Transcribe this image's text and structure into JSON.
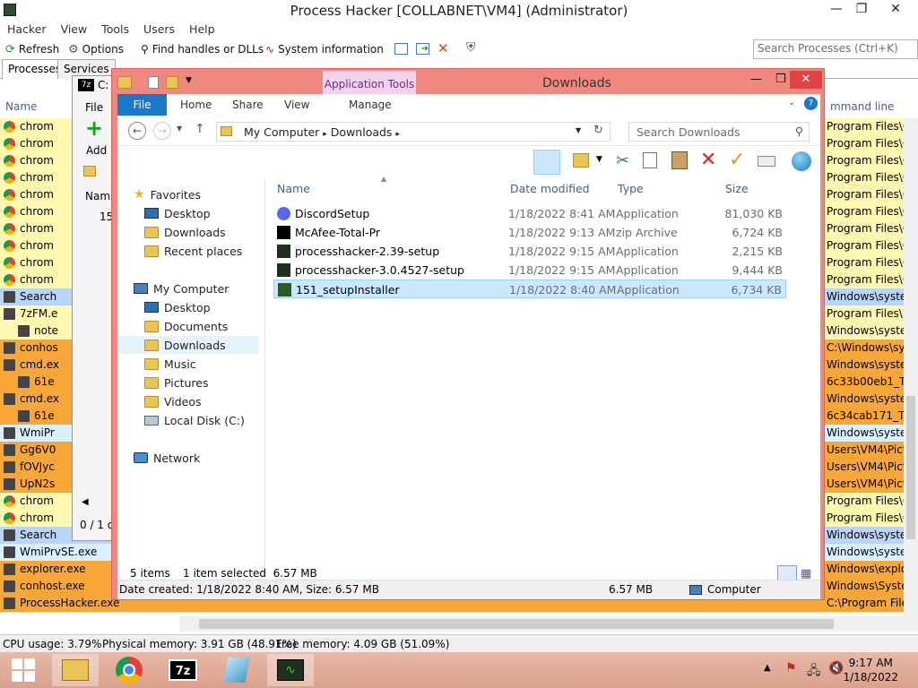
{
  "ph": {
    "title": "Process Hacker [COLLABNET\\VM4] (Administrator)",
    "menu": [
      "Hacker",
      "View",
      "Tools",
      "Users",
      "Help"
    ],
    "toolbar": {
      "refresh": "Refresh",
      "options": "Options",
      "find": "Find handles or DLLs",
      "sysinfo": "System information"
    },
    "search_placeholder": "Search Processes (Ctrl+K)",
    "tabs": [
      "Processes",
      "Services"
    ],
    "col_name": "Name",
    "col_cmd": "mmand line",
    "rows": [
      {
        "name": "chrom",
        "path": "Program Files\\G",
        "color": "#fff8b0"
      },
      {
        "name": "chrom",
        "path": "Program Files\\G",
        "color": "#fff8b0"
      },
      {
        "name": "chrom",
        "path": "Program Files\\G",
        "color": "#fff8b0"
      },
      {
        "name": "chrom",
        "path": "Program Files\\G",
        "color": "#fff8b0"
      },
      {
        "name": "chrom",
        "path": "Program Files\\G",
        "color": "#fff8b0"
      },
      {
        "name": "chrom",
        "path": "Program Files\\G",
        "color": "#fff8b0"
      },
      {
        "name": "chrom",
        "path": "Program Files\\G",
        "color": "#fff8b0"
      },
      {
        "name": "chrom",
        "path": "Program Files\\G",
        "color": "#fff8b0"
      },
      {
        "name": "chrom",
        "path": "Program Files\\G",
        "color": "#fff8b0"
      },
      {
        "name": "chrom",
        "path": "Program Files\\G",
        "color": "#fff8b0"
      },
      {
        "name": "Search",
        "path": "Windows\\syster",
        "color": "#b8d4f8"
      },
      {
        "name": "7zFM.e",
        "path": "Program Files\\7z",
        "color": "#fff8b0"
      },
      {
        "name": "note",
        "path": "Windows\\syster",
        "color": "#fff8b0"
      },
      {
        "name": "conhos",
        "path": "C:\\Windows\\sys",
        "color": "#f7a737"
      },
      {
        "name": "cmd.ex",
        "path": "Windows\\syster",
        "color": "#f7a737"
      },
      {
        "name": "61e",
        "path": "6c33b00eb1_Tue",
        "color": "#f7a737"
      },
      {
        "name": "cmd.ex",
        "path": "Windows\\syster",
        "color": "#f7a737"
      },
      {
        "name": "61e",
        "path": "6c34cab171_Tue",
        "color": "#f7a737"
      },
      {
        "name": "WmiPr",
        "path": "Windows\\syster",
        "color": "#d8f0ff"
      },
      {
        "name": "Gg6V0",
        "path": "Users\\VM4\\Pictu",
        "color": "#f7a737"
      },
      {
        "name": "fOVJyc",
        "path": "Users\\VM4\\Pictu",
        "color": "#f7a737"
      },
      {
        "name": "UpN2s",
        "path": "Users\\VM4\\Pictu",
        "color": "#f7a737"
      },
      {
        "name": "chrom",
        "path": "Program Files\\G",
        "color": "#fff8b0"
      },
      {
        "name": "chrom",
        "path": "Program Files\\G",
        "color": "#fff8b0"
      },
      {
        "name": "Search",
        "path": "Windows\\syster",
        "color": "#b8d4f8"
      },
      {
        "name": "WmiPrvSE.exe",
        "path": "Windows\\syster",
        "color": "#d8f0ff"
      },
      {
        "name": "explorer.exe",
        "path": "Windows\\explore",
        "color": "#f7a737"
      },
      {
        "name": "conhost.exe",
        "path": "Windows\\Syster",
        "color": "#f7a737"
      },
      {
        "name": "ProcessHacker.exe",
        "path": "C:\\Program Files\\P",
        "color": "#f7a737"
      }
    ],
    "status": {
      "cpu": "CPU usage: 3.79%",
      "phys": "Physical memory: 3.91 GB (48.91%)",
      "free": "Free memory: 4.09 GB (51.09%)"
    }
  },
  "z7": {
    "title": "C:",
    "file": "File",
    "add": "Add",
    "name_col": "Nam",
    "item": "15",
    "status": "0 / 1 o"
  },
  "explorer": {
    "title": "Downloads",
    "app_tools": "Application Tools",
    "tabs": [
      "File",
      "Home",
      "Share",
      "View",
      "Manage"
    ],
    "address": [
      "My Computer",
      "Downloads"
    ],
    "search_placeholder": "Search Downloads",
    "nav": {
      "favorites": "Favorites",
      "fav_items": [
        "Desktop",
        "Downloads",
        "Recent places"
      ],
      "computer": "My Computer",
      "comp_items": [
        "Desktop",
        "Documents",
        "Downloads",
        "Music",
        "Pictures",
        "Videos",
        "Local Disk (C:)"
      ],
      "network": "Network"
    },
    "columns": {
      "name": "Name",
      "date": "Date modified",
      "type": "Type",
      "size": "Size"
    },
    "files": [
      {
        "name": "DiscordSetup",
        "date": "1/18/2022 8:41 AM",
        "type": "Application",
        "size": "81,030 KB"
      },
      {
        "name": "McAfee-Total-Pr",
        "date": "1/18/2022 9:13 AM",
        "type": "zip Archive",
        "size": "6,724 KB"
      },
      {
        "name": "processhacker-2.39-setup",
        "date": "1/18/2022 9:15 AM",
        "type": "Application",
        "size": "2,215 KB"
      },
      {
        "name": "processhacker-3.0.4527-setup",
        "date": "1/18/2022 9:15 AM",
        "type": "Application",
        "size": "9,444 KB"
      },
      {
        "name": "151_setupInstaller",
        "date": "1/18/2022 8:40 AM",
        "type": "Application",
        "size": "6,734 KB"
      }
    ],
    "items_count": "5 items",
    "selected": "1 item selected  6.57 MB",
    "details": "Date created: 1/18/2022 8:40 AM, Size: 6.57 MB",
    "details_size": "6.57 MB",
    "details_loc": "Computer"
  },
  "clock": {
    "time": "9:17 AM",
    "date": "1/18/2022"
  }
}
